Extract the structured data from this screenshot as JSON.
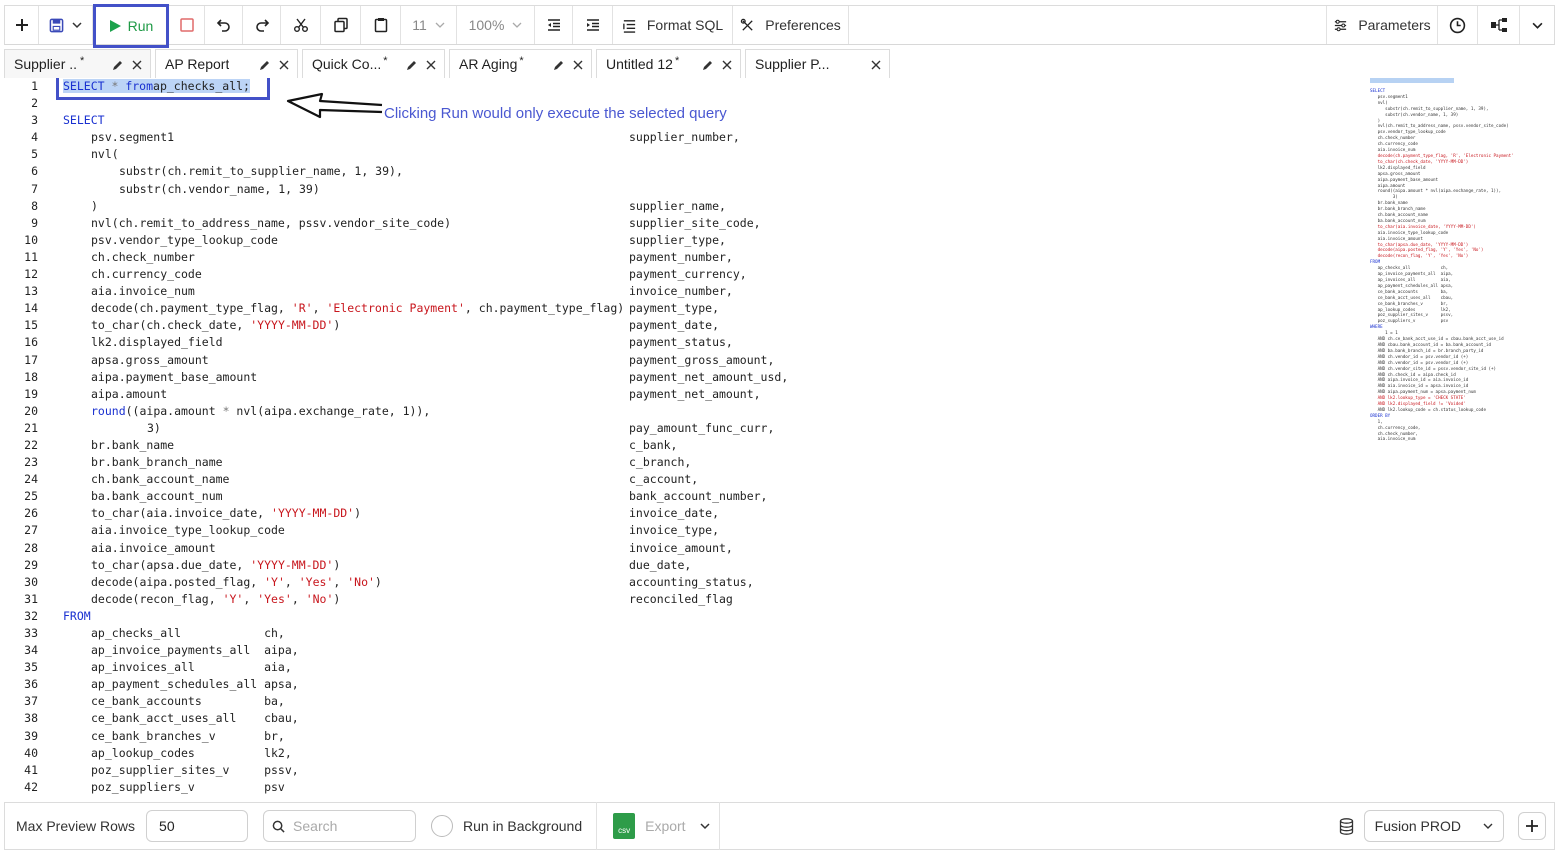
{
  "toolbar": {
    "run_label": "Run",
    "font_size": "11",
    "zoom": "100%",
    "format_sql_label": "Format SQL",
    "preferences_label": "Preferences",
    "parameters_label": "Parameters"
  },
  "tabs": [
    {
      "label": "Supplier ...",
      "modified": "*"
    },
    {
      "label": "AP Report",
      "modified": ""
    },
    {
      "label": "Quick Co...",
      "modified": "*"
    },
    {
      "label": "AR Aging",
      "modified": "*"
    },
    {
      "label": "Untitled 12",
      "modified": "*"
    },
    {
      "label": "Supplier P...",
      "modified": ""
    }
  ],
  "annotation": "Clicking Run would only execute the selected query",
  "line_numbers": [
    "1",
    "2",
    "3",
    "4",
    "5",
    "6",
    "7",
    "8",
    "9",
    "10",
    "11",
    "12",
    "13",
    "14",
    "15",
    "16",
    "17",
    "18",
    "19",
    "20",
    "21",
    "22",
    "23",
    "24",
    "25",
    "26",
    "27",
    "28",
    "29",
    "30",
    "31",
    "32",
    "33",
    "34",
    "35",
    "36",
    "37",
    "38",
    "39",
    "40",
    "41",
    "42"
  ],
  "code_lines": [
    {
      "indent": 0,
      "tokens": [
        [
          "kw",
          "SELECT"
        ],
        [
          "op",
          " * "
        ],
        [
          "kw",
          "from"
        ],
        [
          "",
          "ap_checks_all;"
        ]
      ],
      "alias": "",
      "selected": true
    },
    {
      "indent": 0,
      "tokens": [],
      "alias": ""
    },
    {
      "indent": 0,
      "tokens": [
        [
          "kw",
          "SELECT"
        ]
      ],
      "alias": ""
    },
    {
      "indent": 1,
      "tokens": [
        [
          "",
          "psv.segment1"
        ]
      ],
      "alias": "supplier_number,"
    },
    {
      "indent": 1,
      "tokens": [
        [
          "",
          "nvl("
        ]
      ],
      "alias": ""
    },
    {
      "indent": 2,
      "tokens": [
        [
          "",
          "substr(ch.remit_to_supplier_name, 1, 39),"
        ]
      ],
      "alias": ""
    },
    {
      "indent": 2,
      "tokens": [
        [
          "",
          "substr(ch.vendor_name, 1, 39)"
        ]
      ],
      "alias": ""
    },
    {
      "indent": 1,
      "tokens": [
        [
          "",
          ")"
        ]
      ],
      "alias": "supplier_name,"
    },
    {
      "indent": 1,
      "tokens": [
        [
          "",
          "nvl(ch.remit_to_address_name, pssv.vendor_site_code)"
        ]
      ],
      "alias": "supplier_site_code,"
    },
    {
      "indent": 1,
      "tokens": [
        [
          "",
          "psv.vendor_type_lookup_code"
        ]
      ],
      "alias": "supplier_type,"
    },
    {
      "indent": 1,
      "tokens": [
        [
          "",
          "ch.check_number"
        ]
      ],
      "alias": "payment_number,"
    },
    {
      "indent": 1,
      "tokens": [
        [
          "",
          "ch.currency_code"
        ]
      ],
      "alias": "payment_currency,"
    },
    {
      "indent": 1,
      "tokens": [
        [
          "",
          "aia.invoice_num"
        ]
      ],
      "alias": "invoice_number,"
    },
    {
      "indent": 1,
      "tokens": [
        [
          "",
          "decode(ch.payment_type_flag, "
        ],
        [
          "str",
          "'R'"
        ],
        [
          "",
          ", "
        ],
        [
          "str",
          "'Electronic Payment'"
        ],
        [
          "",
          ", ch.payment_type_flag)"
        ]
      ],
      "alias": "payment_type,"
    },
    {
      "indent": 1,
      "tokens": [
        [
          "",
          "to_char(ch.check_date, "
        ],
        [
          "str",
          "'YYYY-MM-DD'"
        ],
        [
          "",
          ")"
        ]
      ],
      "alias": "payment_date,"
    },
    {
      "indent": 1,
      "tokens": [
        [
          "",
          "lk2.displayed_field"
        ]
      ],
      "alias": "payment_status,"
    },
    {
      "indent": 1,
      "tokens": [
        [
          "",
          "apsa.gross_amount"
        ]
      ],
      "alias": "payment_gross_amount,"
    },
    {
      "indent": 1,
      "tokens": [
        [
          "",
          "aipa.payment_base_amount"
        ]
      ],
      "alias": "payment_net_amount_usd,"
    },
    {
      "indent": 1,
      "tokens": [
        [
          "",
          "aipa.amount"
        ]
      ],
      "alias": "payment_net_amount,"
    },
    {
      "indent": 1,
      "tokens": [
        [
          "kw",
          "round"
        ],
        [
          "",
          "((aipa.amount "
        ],
        [
          "op",
          "*"
        ],
        [
          "",
          " nvl(aipa.exchange_rate, 1)),"
        ]
      ],
      "alias": ""
    },
    {
      "indent": 3,
      "tokens": [
        [
          "",
          "3)"
        ]
      ],
      "alias": "pay_amount_func_curr,"
    },
    {
      "indent": 1,
      "tokens": [
        [
          "",
          "br.bank_name"
        ]
      ],
      "alias": "c_bank,"
    },
    {
      "indent": 1,
      "tokens": [
        [
          "",
          "br.bank_branch_name"
        ]
      ],
      "alias": "c_branch,"
    },
    {
      "indent": 1,
      "tokens": [
        [
          "",
          "ch.bank_account_name"
        ]
      ],
      "alias": "c_account,"
    },
    {
      "indent": 1,
      "tokens": [
        [
          "",
          "ba.bank_account_num"
        ]
      ],
      "alias": "bank_account_number,"
    },
    {
      "indent": 1,
      "tokens": [
        [
          "",
          "to_char(aia.invoice_date, "
        ],
        [
          "str",
          "'YYYY-MM-DD'"
        ],
        [
          "",
          ")"
        ]
      ],
      "alias": "invoice_date,"
    },
    {
      "indent": 1,
      "tokens": [
        [
          "",
          "aia.invoice_type_lookup_code"
        ]
      ],
      "alias": "invoice_type,"
    },
    {
      "indent": 1,
      "tokens": [
        [
          "",
          "aia.invoice_amount"
        ]
      ],
      "alias": "invoice_amount,"
    },
    {
      "indent": 1,
      "tokens": [
        [
          "",
          "to_char(apsa.due_date, "
        ],
        [
          "str",
          "'YYYY-MM-DD'"
        ],
        [
          "",
          ")"
        ]
      ],
      "alias": "due_date,"
    },
    {
      "indent": 1,
      "tokens": [
        [
          "",
          "decode(aipa.posted_flag, "
        ],
        [
          "str",
          "'Y'"
        ],
        [
          "",
          ", "
        ],
        [
          "str",
          "'Yes'"
        ],
        [
          "",
          ", "
        ],
        [
          "str",
          "'No'"
        ],
        [
          "",
          ")"
        ]
      ],
      "alias": "accounting_status,"
    },
    {
      "indent": 1,
      "tokens": [
        [
          "",
          "decode(recon_flag, "
        ],
        [
          "str",
          "'Y'"
        ],
        [
          "",
          ", "
        ],
        [
          "str",
          "'Yes'"
        ],
        [
          "",
          ", "
        ],
        [
          "str",
          "'No'"
        ],
        [
          "",
          ")"
        ]
      ],
      "alias": "reconciled_flag"
    },
    {
      "indent": 0,
      "tokens": [
        [
          "kw",
          "FROM"
        ]
      ],
      "alias": ""
    },
    {
      "indent": 1,
      "tokens": [
        [
          "",
          "ap_checks_all            ch,"
        ]
      ],
      "alias": ""
    },
    {
      "indent": 1,
      "tokens": [
        [
          "",
          "ap_invoice_payments_all  aipa,"
        ]
      ],
      "alias": ""
    },
    {
      "indent": 1,
      "tokens": [
        [
          "",
          "ap_invoices_all          aia,"
        ]
      ],
      "alias": ""
    },
    {
      "indent": 1,
      "tokens": [
        [
          "",
          "ap_payment_schedules_all apsa,"
        ]
      ],
      "alias": ""
    },
    {
      "indent": 1,
      "tokens": [
        [
          "",
          "ce_bank_accounts         ba,"
        ]
      ],
      "alias": ""
    },
    {
      "indent": 1,
      "tokens": [
        [
          "",
          "ce_bank_acct_uses_all    cbau,"
        ]
      ],
      "alias": ""
    },
    {
      "indent": 1,
      "tokens": [
        [
          "",
          "ce_bank_branches_v       br,"
        ]
      ],
      "alias": ""
    },
    {
      "indent": 1,
      "tokens": [
        [
          "",
          "ap_lookup_codes          lk2,"
        ]
      ],
      "alias": ""
    },
    {
      "indent": 1,
      "tokens": [
        [
          "",
          "poz_supplier_sites_v     pssv,"
        ]
      ],
      "alias": ""
    },
    {
      "indent": 1,
      "tokens": [
        [
          "",
          "poz_suppliers_v          psv"
        ]
      ],
      "alias": ""
    }
  ],
  "minimap_lines": [
    {
      "k": "kw",
      "t": "SELECT"
    },
    {
      "k": "",
      "t": "   psv.segment1"
    },
    {
      "k": "",
      "t": "   nvl("
    },
    {
      "k": "",
      "t": "      substr(ch.remit_to_supplier_name, 1, 39),"
    },
    {
      "k": "",
      "t": "      substr(ch.vendor_name, 1, 39)"
    },
    {
      "k": "",
      "t": "   )"
    },
    {
      "k": "",
      "t": "   nvl(ch.remit_to_address_name, pssv.vendor_site_code)"
    },
    {
      "k": "",
      "t": "   psv.vendor_type_lookup_code"
    },
    {
      "k": "",
      "t": "   ch.check_number"
    },
    {
      "k": "",
      "t": "   ch.currency_code"
    },
    {
      "k": "",
      "t": "   aia.invoice_num"
    },
    {
      "k": "str",
      "t": "   decode(ch.payment_type_flag, 'R', 'Electronic Payment'"
    },
    {
      "k": "str",
      "t": "   to_char(ch.check_date, 'YYYY-MM-DD')"
    },
    {
      "k": "",
      "t": "   lk2.displayed_field"
    },
    {
      "k": "",
      "t": "   apsa.gross_amount"
    },
    {
      "k": "",
      "t": "   aipa.payment_base_amount"
    },
    {
      "k": "",
      "t": "   aipa.amount"
    },
    {
      "k": "",
      "t": "   round((aipa.amount * nvl(aipa.exchange_rate, 1)),"
    },
    {
      "k": "",
      "t": "         3)"
    },
    {
      "k": "",
      "t": "   br.bank_name"
    },
    {
      "k": "",
      "t": "   br.bank_branch_name"
    },
    {
      "k": "",
      "t": "   ch.bank_account_name"
    },
    {
      "k": "",
      "t": "   ba.bank_account_num"
    },
    {
      "k": "str",
      "t": "   to_char(aia.invoice_date, 'YYYY-MM-DD')"
    },
    {
      "k": "",
      "t": "   aia.invoice_type_lookup_code"
    },
    {
      "k": "",
      "t": "   aia.invoice_amount"
    },
    {
      "k": "str",
      "t": "   to_char(apsa.due_date, 'YYYY-MM-DD')"
    },
    {
      "k": "str",
      "t": "   decode(aipa.posted_flag, 'Y', 'Yes', 'No')"
    },
    {
      "k": "str",
      "t": "   decode(recon_flag, 'Y', 'Yes', 'No')"
    },
    {
      "k": "kw",
      "t": "FROM"
    },
    {
      "k": "",
      "t": "   ap_checks_all            ch,"
    },
    {
      "k": "",
      "t": "   ap_invoice_payments_all  aipa,"
    },
    {
      "k": "",
      "t": "   ap_invoices_all          aia,"
    },
    {
      "k": "",
      "t": "   ap_payment_schedules_all apsa,"
    },
    {
      "k": "",
      "t": "   ce_bank_accounts         ba,"
    },
    {
      "k": "",
      "t": "   ce_bank_acct_uses_all    cbau,"
    },
    {
      "k": "",
      "t": "   ce_bank_branches_v       br,"
    },
    {
      "k": "",
      "t": "   ap_lookup_codes          lk2,"
    },
    {
      "k": "",
      "t": "   poz_supplier_sites_v     pssv,"
    },
    {
      "k": "",
      "t": "   poz_suppliers_v          psv"
    },
    {
      "k": "kw",
      "t": "WHERE"
    },
    {
      "k": "",
      "t": "      1 = 1"
    },
    {
      "k": "",
      "t": "   AND ch.ce_bank_acct_use_id = cbau.bank_acct_use_id"
    },
    {
      "k": "",
      "t": "   AND cbau.bank_account_id = ba.bank_account_id"
    },
    {
      "k": "",
      "t": "   AND ba.bank_branch_id = br.branch_party_id"
    },
    {
      "k": "",
      "t": "   AND ch.vendor_id = psv.vendor_id (+)"
    },
    {
      "k": "",
      "t": "   AND ch.vendor_id = psv.vendor_id (+)"
    },
    {
      "k": "",
      "t": "   AND ch.vendor_site_id = pssv.vendor_site_id (+)"
    },
    {
      "k": "",
      "t": "   AND ch.check_id = aipa.check_id"
    },
    {
      "k": "",
      "t": "   AND aipa.invoice_id = aia.invoice_id"
    },
    {
      "k": "",
      "t": "   AND aia.invoice_id = apsa.invoice_id"
    },
    {
      "k": "",
      "t": "   AND aipa.payment_num = apsa.payment_num"
    },
    {
      "k": "str",
      "t": "   AND lk2.lookup_type = 'CHECK STATE'"
    },
    {
      "k": "str",
      "t": "   AND lk2.displayed_field != 'Voided'"
    },
    {
      "k": "",
      "t": "   AND lk2.lookup_code = ch.status_lookup_code"
    },
    {
      "k": "kw",
      "t": "ORDER BY"
    },
    {
      "k": "",
      "t": "   1,"
    },
    {
      "k": "",
      "t": "   ch.currency_code,"
    },
    {
      "k": "",
      "t": "   ch.check_number,"
    },
    {
      "k": "",
      "t": "   aia.invoice_num"
    }
  ],
  "footer": {
    "max_rows_label": "Max Preview Rows",
    "max_rows_value": "50",
    "search_placeholder": "Search",
    "run_background_label": "Run in Background",
    "csv_label": "csv",
    "export_label": "Export",
    "environment": "Fusion PROD"
  },
  "colors": {
    "accent_border": "#4351c8",
    "run_green": "#1ca24c",
    "keyword": "#1930d0",
    "string": "#c8161d",
    "selection": "#bcd4f6"
  }
}
